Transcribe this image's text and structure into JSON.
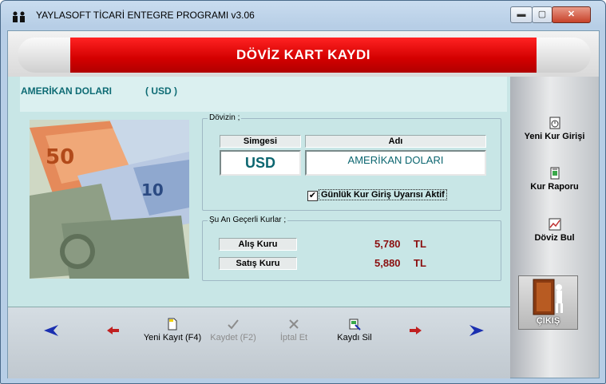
{
  "window": {
    "title": "YAYLASOFT TİCARİ ENTEGRE PROGRAMI v3.06",
    "minimize": "▬",
    "maximize": "▢",
    "close": "✕"
  },
  "banner": {
    "title": "DÖVİZ KART KAYDI"
  },
  "header": {
    "currency_name": "AMERİKAN DOLARI",
    "currency_code": "( USD )"
  },
  "currency_group": {
    "label": "Dövizin ;",
    "symbol_header": "Simgesi",
    "name_header": "Adı",
    "symbol_value": "USD",
    "name_value": "AMERİKAN DOLARI",
    "alert_checkbox_label": "Günlük Kur Giriş Uyarısı Aktif",
    "alert_checked": true,
    "check_mark": "✔"
  },
  "rates_group": {
    "label": "Şu An Geçerli Kurlar ;",
    "buy_label": "Alış Kuru",
    "buy_value": "5,780",
    "buy_unit": "TL",
    "sell_label": "Satış Kuru",
    "sell_value": "5,880",
    "sell_unit": "TL"
  },
  "sidebar": {
    "items": [
      {
        "label": "Yeni Kur Girişi",
        "icon": "clock-icon"
      },
      {
        "label": "Kur Raporu",
        "icon": "report-icon"
      },
      {
        "label": "Döviz Bul",
        "icon": "chart-icon"
      }
    ],
    "exit_label": "ÇIKIŞ"
  },
  "toolbar": {
    "new_label": "Yeni Kayıt (F4)",
    "save_label": "Kaydet (F2)",
    "cancel_label": "İptal Et",
    "delete_label": "Kaydı Sil"
  },
  "colors": {
    "accent_red": "#d30000",
    "teal_text": "#0e6b74",
    "rate_text": "#8b1010"
  }
}
